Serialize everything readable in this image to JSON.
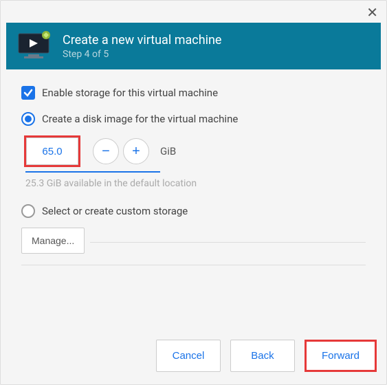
{
  "header": {
    "title": "Create a new virtual machine",
    "step": "Step 4 of 5"
  },
  "storage": {
    "enable_label": "Enable storage for this virtual machine",
    "create_disk_label": "Create a disk image for the virtual machine",
    "size_value": "65.0",
    "unit": "GiB",
    "available_hint": "25.3 GiB available in the default location",
    "custom_label": "Select or create custom storage",
    "manage_label": "Manage..."
  },
  "footer": {
    "cancel": "Cancel",
    "back": "Back",
    "forward": "Forward"
  }
}
